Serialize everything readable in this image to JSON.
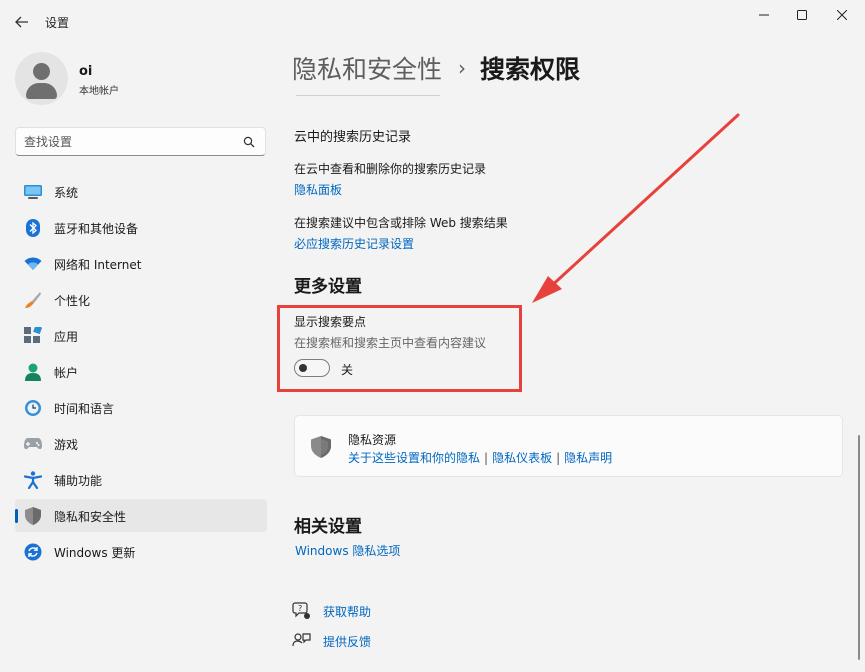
{
  "window": {
    "title": "设置"
  },
  "profile": {
    "name": "oi",
    "account_type": "本地帐户"
  },
  "search": {
    "placeholder": "查找设置"
  },
  "sidebar": {
    "items": [
      {
        "label": "系统",
        "icon": "system-icon",
        "active": false
      },
      {
        "label": "蓝牙和其他设备",
        "icon": "bluetooth-icon",
        "active": false
      },
      {
        "label": "网络和 Internet",
        "icon": "wifi-icon",
        "active": false
      },
      {
        "label": "个性化",
        "icon": "brush-icon",
        "active": false
      },
      {
        "label": "应用",
        "icon": "apps-icon",
        "active": false
      },
      {
        "label": "帐户",
        "icon": "account-icon",
        "active": false
      },
      {
        "label": "时间和语言",
        "icon": "clock-globe-icon",
        "active": false
      },
      {
        "label": "游戏",
        "icon": "gamepad-icon",
        "active": false
      },
      {
        "label": "辅助功能",
        "icon": "accessibility-icon",
        "active": false
      },
      {
        "label": "隐私和安全性",
        "icon": "shield-icon",
        "active": true
      },
      {
        "label": "Windows 更新",
        "icon": "update-icon",
        "active": false
      }
    ]
  },
  "breadcrumb": {
    "parent": "隐私和安全性",
    "separator": "›",
    "current": "搜索权限"
  },
  "cloud_history": {
    "heading": "云中的搜索历史记录",
    "row1_text": "在云中查看和删除你的搜索历史记录",
    "row1_link": "隐私面板",
    "row2_text": "在搜索建议中包含或排除 Web 搜索结果",
    "row2_link": "必应搜索历史记录设置"
  },
  "more_settings": {
    "heading": "更多设置",
    "toggle_title": "显示搜索要点",
    "toggle_desc": "在搜索框和搜索主页中查看内容建议",
    "toggle_state": "关",
    "toggle_on": false
  },
  "privacy_resources": {
    "title": "隐私资源",
    "link1": "关于这些设置和你的隐私",
    "sep": "|",
    "link2": "隐私仪表板",
    "link3": "隐私声明"
  },
  "related": {
    "heading": "相关设置",
    "link": "Windows 隐私选项"
  },
  "footer": {
    "help": "获取帮助",
    "feedback": "提供反馈"
  },
  "colors": {
    "accent": "#005fb8",
    "link": "#0067c0",
    "annotation_red": "#e8413b"
  }
}
